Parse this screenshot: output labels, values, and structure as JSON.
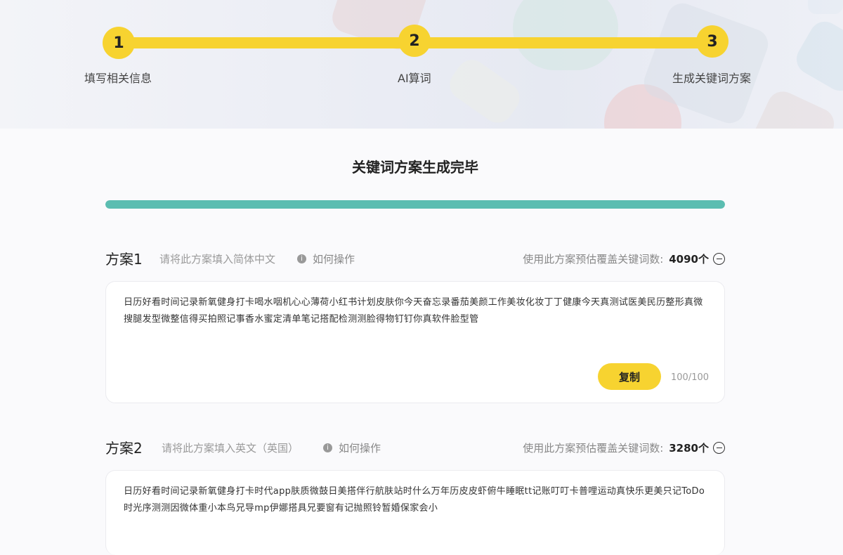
{
  "steps": [
    {
      "number": "1",
      "label": "填写相关信息"
    },
    {
      "number": "2",
      "label": "AI算词"
    },
    {
      "number": "3",
      "label": "生成关键词方案"
    }
  ],
  "page_title": "关键词方案生成完毕",
  "progress_percent": 100,
  "colors": {
    "accent_yellow": "#f7d330",
    "progress_teal": "#5bbdb1"
  },
  "plans": [
    {
      "title": "方案1",
      "hint": "请将此方案填入简体中文",
      "howto_label": "如何操作",
      "coverage_label": "使用此方案预估覆盖关键词数:",
      "coverage_count": "4090个",
      "keywords": "日历好看时间记录新氧健身打卡喝水咽机心心薄荷小红书计划皮肤你今天奋忘录番茄美颜工作美妆化妆丁丁健康今天真测试医美民历整形真微搜腿发型微整信得买拍照记事香水蜜定清单笔记搭配检测测脸得物钉钉你真软件脸型管",
      "copy_label": "复制",
      "char_count": "100/100"
    },
    {
      "title": "方案2",
      "hint": "请将此方案填入英文（英国）",
      "howto_label": "如何操作",
      "coverage_label": "使用此方案预估覆盖关键词数:",
      "coverage_count": "3280个",
      "keywords": "日历好看时间记录新氧健身打卡时代app肤质微鼓日美搭伴行航肤站时什么万年历皮皮虾俯牛睡眠tt记账叮叮卡普哩运动真快乐更美只记ToDo时光序测测因微体重小本鸟兄导mp伊娜搭具兄要窗有记抛照铃暂婚保家会小"
    }
  ]
}
